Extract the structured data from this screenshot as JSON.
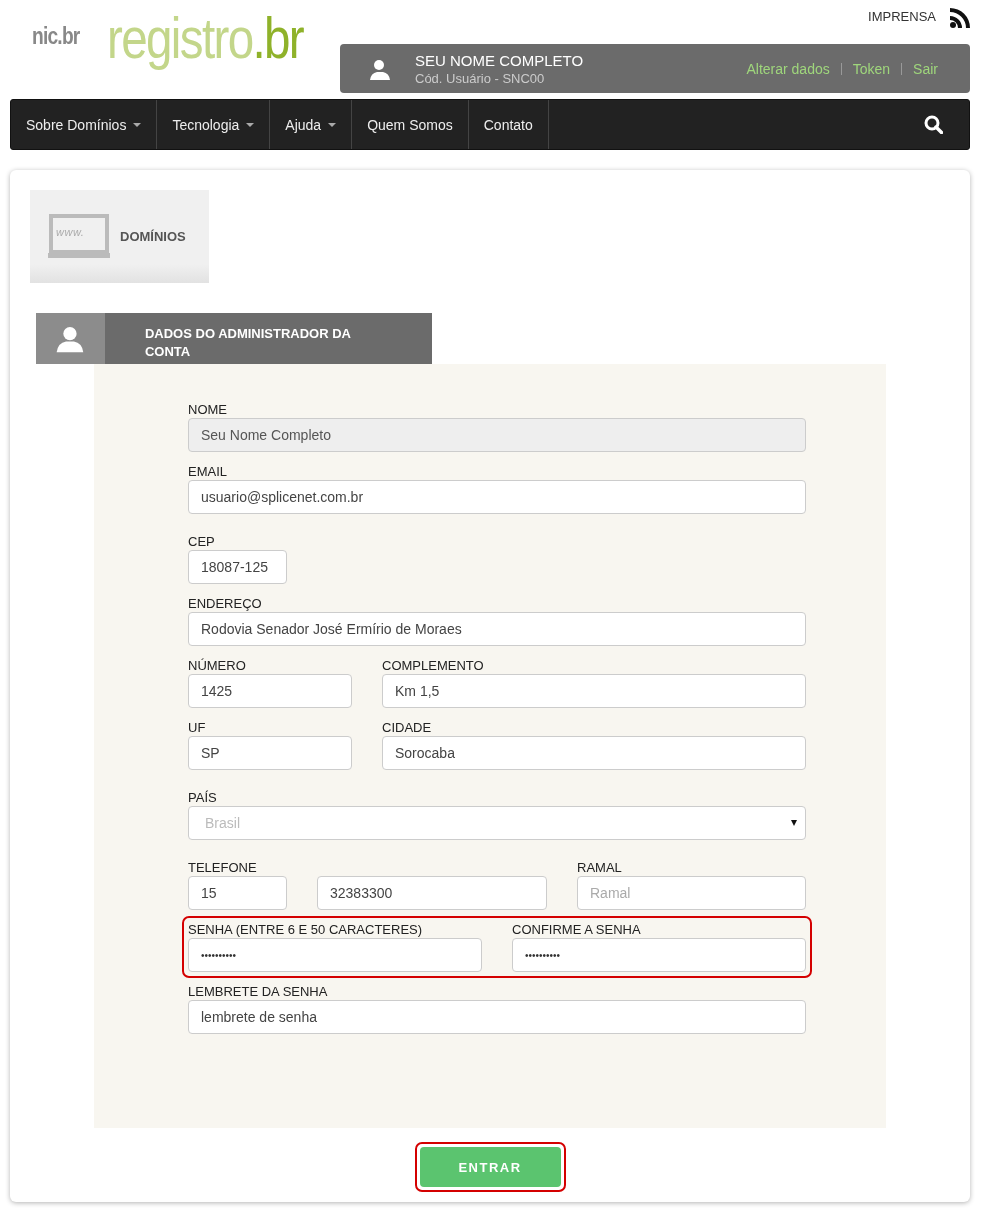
{
  "header": {
    "logo": {
      "org": "nic.br",
      "site_name": "registro",
      "site_tld": ".br"
    },
    "press_link": "IMPRENSA",
    "user_bar": {
      "name": "SEU NOME COMPLETO",
      "user_code": "Cód. Usuário - SNC00",
      "links": [
        "Alterar dados",
        "Token",
        "Sair"
      ]
    }
  },
  "nav": {
    "items": [
      {
        "label": "Sobre Domínios",
        "dropdown": true
      },
      {
        "label": "Tecnologia",
        "dropdown": true
      },
      {
        "label": "Ajuda",
        "dropdown": true
      },
      {
        "label": "Quem Somos",
        "dropdown": false
      },
      {
        "label": "Contato",
        "dropdown": false
      }
    ]
  },
  "domains_tile": {
    "icon_text": "www.",
    "label": "DOMÍNIOS"
  },
  "section_header": {
    "title": "DADOS DO ADMINISTRADOR DA CONTA"
  },
  "form": {
    "sections": [
      [
        {
          "kind": "wide",
          "highlighted": false,
          "fields": [
            {
              "label": "NOME",
              "kind": "text",
              "value": "Seu Nome Completo",
              "disabled": true
            }
          ]
        },
        {
          "kind": "wide",
          "highlighted": false,
          "fields": [
            {
              "label": "EMAIL",
              "kind": "text",
              "value": "usuario@splicenet.com.br",
              "disabled": false
            }
          ]
        }
      ],
      [
        {
          "kind": "short",
          "highlighted": false,
          "fields": [
            {
              "label": "CEP",
              "kind": "text",
              "value": "18087-125",
              "disabled": false
            }
          ]
        },
        {
          "kind": "wide",
          "highlighted": false,
          "fields": [
            {
              "label": "ENDEREÇO",
              "kind": "text",
              "value": "Rodovia Senador José Ermírio de Moraes",
              "disabled": false
            }
          ]
        },
        {
          "kind": "split",
          "highlighted": false,
          "fields": [
            {
              "label": "NÚMERO",
              "kind": "text",
              "value": "1425",
              "disabled": false
            },
            {
              "label": "COMPLEMENTO",
              "kind": "text",
              "value": "Km 1,5",
              "disabled": false
            }
          ]
        },
        {
          "kind": "split",
          "highlighted": false,
          "fields": [
            {
              "label": "UF",
              "kind": "text",
              "value": "SP",
              "disabled": false
            },
            {
              "label": "CIDADE",
              "kind": "text",
              "value": "Sorocaba",
              "disabled": false
            }
          ]
        }
      ],
      [
        {
          "kind": "wide",
          "highlighted": false,
          "fields": [
            {
              "label": "PAÍS",
              "kind": "select",
              "placeholder": "Brasil",
              "disabled": false
            }
          ]
        }
      ],
      [
        {
          "kind": "phone",
          "highlighted": false,
          "fields": [
            {
              "label": "TELEFONE",
              "kind": "text",
              "value": "15",
              "disabled": false
            },
            {
              "kind": "text",
              "value": "32383300",
              "disabled": false
            },
            {
              "label": "RAMAL",
              "kind": "text",
              "placeholder": "Ramal",
              "disabled": false
            }
          ]
        },
        {
          "kind": "halves",
          "highlighted": true,
          "fields": [
            {
              "label": "SENHA (ENTRE 6 E 50 CARACTERES)",
              "kind": "password",
              "value": "••••••••••",
              "disabled": false
            },
            {
              "label": "CONFIRME A SENHA",
              "kind": "password",
              "value": "••••••••••",
              "disabled": false
            }
          ]
        },
        {
          "kind": "wide",
          "highlighted": false,
          "fields": [
            {
              "label": "LEMBRETE DA SENHA",
              "kind": "text",
              "value": "lembrete de senha",
              "disabled": false
            }
          ]
        }
      ]
    ]
  },
  "submit": {
    "label": "ENTRAR",
    "highlighted": true
  }
}
